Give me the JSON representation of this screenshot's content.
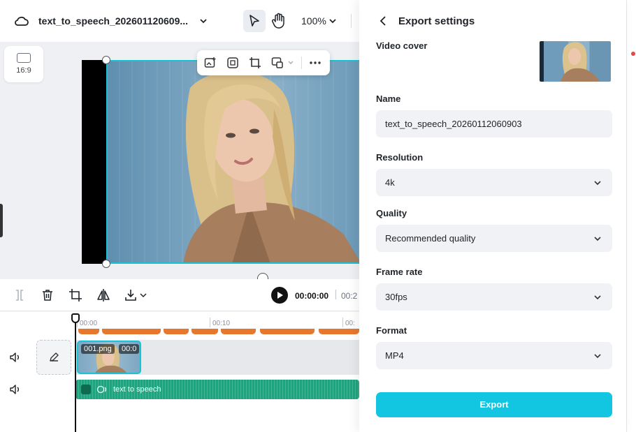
{
  "header": {
    "project_title": "text_to_speech_202601120609...",
    "zoom": "100%"
  },
  "canvas": {
    "aspect_ratio": "16:9"
  },
  "timeline": {
    "current_time": "00:00:00",
    "total_time": "00:2",
    "ruler_labels": [
      "00:00",
      "00:10",
      "00:"
    ],
    "video_clip": {
      "name": "001.png",
      "duration": "00:0"
    },
    "audio_clip": {
      "label": "text to speech"
    }
  },
  "export_panel": {
    "title": "Export settings",
    "video_cover_label": "Video cover",
    "name_label": "Name",
    "name_value": "text_to_speech_20260112060903",
    "resolution_label": "Resolution",
    "resolution_value": "4k",
    "quality_label": "Quality",
    "quality_value": "Recommended quality",
    "frame_rate_label": "Frame rate",
    "frame_rate_value": "30fps",
    "format_label": "Format",
    "format_value": "MP4",
    "export_button": "Export"
  },
  "colors": {
    "accent": "#12c5e0",
    "selection": "#19c3d6",
    "caption_track": "#e8772e",
    "audio_track": "#1aa67f"
  }
}
